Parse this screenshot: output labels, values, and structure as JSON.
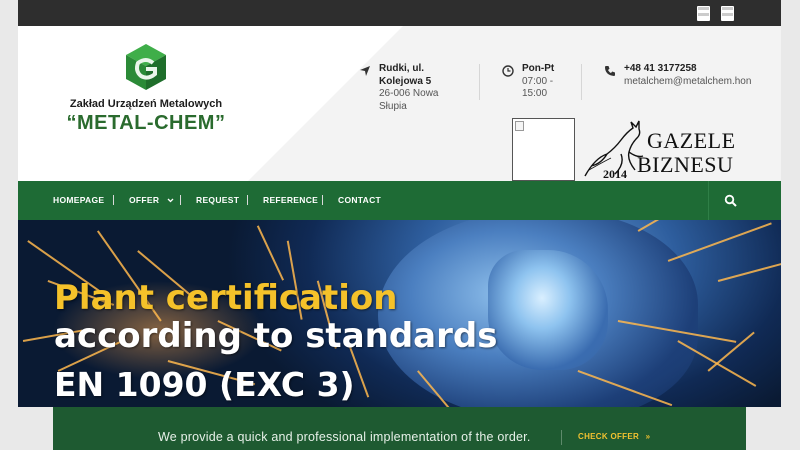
{
  "topbar": {
    "flags": [
      {
        "icon": "flag-icon",
        "label": ""
      },
      {
        "icon": "flag-icon",
        "label": ""
      }
    ]
  },
  "company": {
    "name": "Zakład Urządzeń Metalowych",
    "brand": "“METAL-CHEM”",
    "logo_icon": "metal-chem-cube-logo",
    "color_brand": "#2a6b2e"
  },
  "contact": {
    "address": {
      "icon": "location-arrow-icon",
      "line1": "Rudki, ul.",
      "line2": "Kolejowa 5",
      "line3": "26-006 Nowa",
      "line4": "Słupia"
    },
    "hours": {
      "icon": "clock-icon",
      "days": "Pon-Pt",
      "line1": "07:00 -",
      "line2": "15:00"
    },
    "phone": {
      "icon": "phone-icon",
      "number": "+48 41 3177258",
      "email": "metalchem@metalchem.hon"
    }
  },
  "award": {
    "line1": "GAZELE",
    "line2": "BIZNESU",
    "year": "2014"
  },
  "nav": {
    "items": [
      {
        "label": "HOMEPAGE"
      },
      {
        "label": "OFFER",
        "has_dropdown": true
      },
      {
        "label": "REQUEST"
      },
      {
        "label": "REFERENCE"
      },
      {
        "label": "CONTACT"
      }
    ],
    "dropdown_icon": "chevron-down-icon",
    "search_icon": "search-icon",
    "color_bg": "#1e6b35"
  },
  "hero": {
    "line1": "Plant certification",
    "line2": "according to standards",
    "line3": "EN 1090 (EXC 3)",
    "color_highlight": "#f5c22a"
  },
  "cta": {
    "text": "We provide a quick and professional implementation of the order.",
    "button": "CHECK OFFER",
    "button_icon": "double-chevron-right-icon",
    "color_button": "#f2c230"
  }
}
